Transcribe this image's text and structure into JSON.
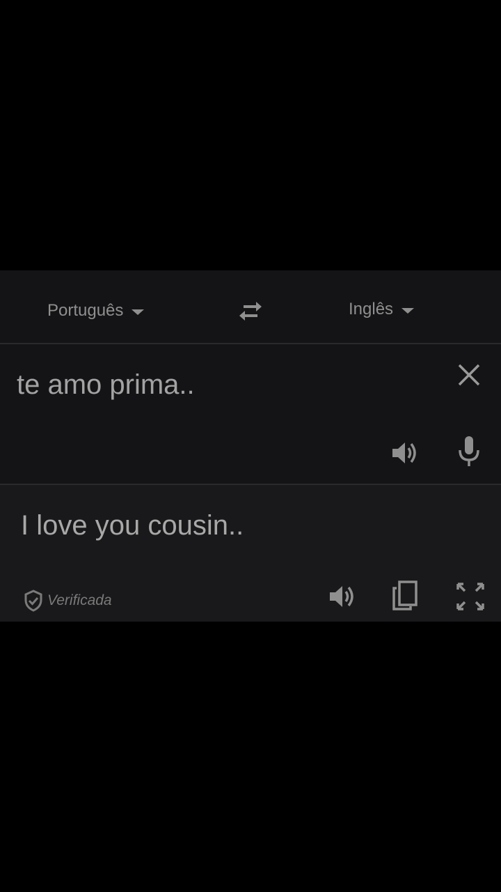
{
  "languages": {
    "source": "Português",
    "target": "Inglês"
  },
  "source": {
    "text": "te amo prima.."
  },
  "translation": {
    "text": "I love you cousin..",
    "verified_label": "Verificada"
  },
  "icons": {
    "swap": "swap-arrows-icon",
    "clear": "close-icon",
    "listen_source": "speaker-icon",
    "voice_input": "microphone-icon",
    "verified": "shield-check-icon",
    "listen_translation": "speaker-icon",
    "copy": "copy-icon",
    "fullscreen": "fullscreen-icon"
  },
  "colors": {
    "background": "#000000",
    "panel": "#141416",
    "translation_panel": "#19191b",
    "text": "#a3a3a3",
    "muted_text": "#7a7a7a"
  }
}
